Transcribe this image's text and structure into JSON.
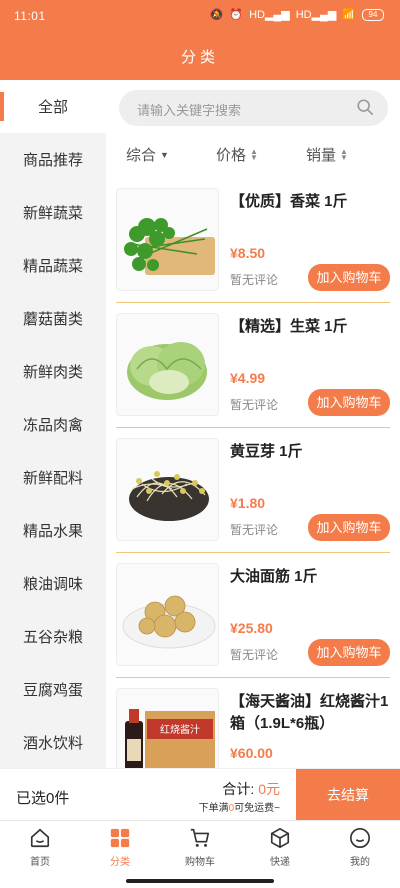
{
  "status_bar": {
    "time": "11:01",
    "signal_labels": [
      "HD",
      "HD"
    ],
    "battery": "94"
  },
  "header": {
    "title": "分类"
  },
  "sidebar": {
    "items": [
      {
        "label": "全部",
        "active": true
      },
      {
        "label": "商品推荐"
      },
      {
        "label": "新鲜蔬菜"
      },
      {
        "label": "精品蔬菜"
      },
      {
        "label": "蘑菇菌类"
      },
      {
        "label": "新鲜肉类"
      },
      {
        "label": "冻品肉禽"
      },
      {
        "label": "新鲜配料"
      },
      {
        "label": "精品水果"
      },
      {
        "label": "粮油调味"
      },
      {
        "label": "五谷杂粮"
      },
      {
        "label": "豆腐鸡蛋"
      },
      {
        "label": "酒水饮料"
      }
    ]
  },
  "search": {
    "placeholder": "请输入关键字搜索"
  },
  "sort": {
    "comprehensive": "综合",
    "price": "价格",
    "sales": "销量"
  },
  "products": [
    {
      "name": "【优质】香菜 1斤",
      "price": "¥8.50",
      "review": "暂无评论",
      "button": "加入购物车"
    },
    {
      "name": "【精选】生菜 1斤",
      "price": "¥4.99",
      "review": "暂无评论",
      "button": "加入购物车"
    },
    {
      "name": "黄豆芽 1斤",
      "price": "¥1.80",
      "review": "暂无评论",
      "button": "加入购物车"
    },
    {
      "name": "大油面筋 1斤",
      "price": "¥25.80",
      "review": "暂无评论",
      "button": "加入购物车"
    },
    {
      "name": "【海天酱油】红烧酱汁1箱（1.9L*6瓶）",
      "price": "¥60.00",
      "review": "",
      "button": "",
      "image_text": "红烧酱汁"
    }
  ],
  "checkout": {
    "selected": "已选0件",
    "total_label": "合计:",
    "total_amount": "0元",
    "free_ship_prefix": "下单满",
    "free_ship_amount": "0",
    "free_ship_suffix": "可免运费~",
    "settle": "去结算"
  },
  "tabbar": {
    "items": [
      {
        "label": "首页",
        "icon": "home-icon"
      },
      {
        "label": "分类",
        "icon": "category-icon",
        "active": true
      },
      {
        "label": "购物车",
        "icon": "cart-icon"
      },
      {
        "label": "快递",
        "icon": "box-icon"
      },
      {
        "label": "我的",
        "icon": "profile-icon"
      }
    ]
  },
  "colors": {
    "accent": "#f47c4b",
    "divider": "#f0c878"
  }
}
